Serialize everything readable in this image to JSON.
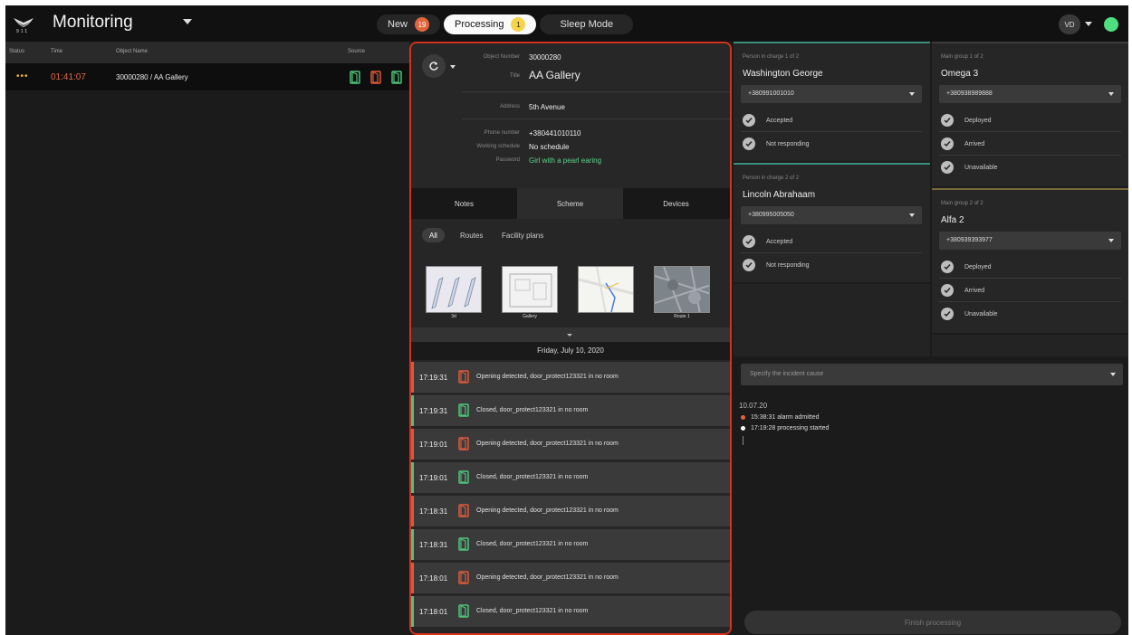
{
  "topbar": {
    "logo_text": "911",
    "title": "Monitoring",
    "tabs": [
      {
        "label": "New",
        "count": "19"
      },
      {
        "label": "Processing",
        "count": "1"
      },
      {
        "label": "Sleep Mode"
      }
    ],
    "avatar": "VD",
    "online_color": "#4ee080"
  },
  "list": {
    "headers": {
      "status": "Status",
      "time": "Time",
      "object": "Object Name",
      "source": "Source"
    },
    "rows": [
      {
        "status": "•••",
        "time": "01:41:07",
        "object": "30000280 / AA Gallery",
        "sources": [
          "door-green-icon",
          "door-red-icon",
          "door-green-icon"
        ]
      }
    ]
  },
  "object": {
    "number_label": "Object Number",
    "number": "30000280",
    "title_label": "Title",
    "title": "AA Gallery",
    "address_label": "Address",
    "address": "5th Avenue",
    "phone_label": "Phone number",
    "phone": "+380441010110",
    "schedule_label": "Working schedule",
    "schedule": "No schedule",
    "password_label": "Password",
    "password": "Girl with a pearl earing"
  },
  "middle_tabs": [
    "Notes",
    "Scheme",
    "Devices"
  ],
  "filters": [
    "All",
    "Routes",
    "Facility plans"
  ],
  "thumbnails": [
    "3d",
    "Gallery",
    "",
    "Route 1"
  ],
  "date_header": "Friday, July 10, 2020",
  "events": [
    {
      "time": "17:19:31",
      "type": "open",
      "text": "Opening detected, door_protect123321 in no room"
    },
    {
      "time": "17:19:31",
      "type": "closed",
      "text": "Closed, door_protect123321 in no room"
    },
    {
      "time": "17:19:01",
      "type": "open",
      "text": "Opening detected, door_protect123321 in no room"
    },
    {
      "time": "17:19:01",
      "type": "closed",
      "text": "Closed, door_protect123321 in no room"
    },
    {
      "time": "17:18:31",
      "type": "open",
      "text": "Opening detected, door_protect123321 in no room"
    },
    {
      "time": "17:18:31",
      "type": "closed",
      "text": "Closed, door_protect123321 in no room"
    },
    {
      "time": "17:18:01",
      "type": "open",
      "text": "Opening detected, door_protect123321 in no room"
    },
    {
      "time": "17:18:01",
      "type": "closed",
      "text": "Closed, door_protect123321 in no room"
    }
  ],
  "persons": [
    {
      "label": "Person in charge 1 of 2",
      "name": "Washington George",
      "phone": "+380991001010",
      "statuses": [
        "Accepted",
        "Not responding"
      ]
    },
    {
      "label": "Person in charge 2 of 2",
      "name": "Lincoln Abrahaam",
      "phone": "+380995005050",
      "statuses": [
        "Accepted",
        "Not responding"
      ]
    }
  ],
  "groups": [
    {
      "label": "Main group 1 of 2",
      "name": "Omega 3",
      "phone": "+380938989888",
      "statuses": [
        "Deployed",
        "Arrived",
        "Unavailable"
      ]
    },
    {
      "label": "Main group 2 of 2",
      "name": "Alfa 2",
      "phone": "+380939393977",
      "statuses": [
        "Deployed",
        "Arrived",
        "Unavailable"
      ]
    }
  ],
  "incident": {
    "cause_placeholder": "Specify the incident cause",
    "log_date": "10.07.20",
    "log": [
      {
        "text": "15:38:31 alarm admitted",
        "color": "#e0643c"
      },
      {
        "text": "17:19:28 processing started",
        "color": "#ffffff"
      }
    ],
    "finish_label": "Finish processing"
  },
  "colors": {
    "alert_red": "#d2321e",
    "open_red": "#dc5a3c",
    "closed_green": "#4ec47a",
    "password_green": "#60d38a",
    "status_orange": "#f0b43c"
  }
}
